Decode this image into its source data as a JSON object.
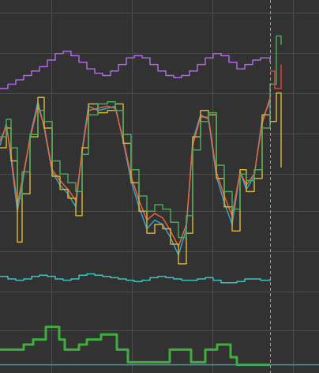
{
  "colors": {
    "background": "#323232",
    "grid": "#4d4d4d",
    "cursor": "#9a9a9a"
  },
  "chart_data": {
    "type": "line",
    "grid": true,
    "cursor_x": 342,
    "x_range": [
      0,
      404
    ],
    "panels": [
      {
        "name": "",
        "y_range": [
          0,
          110
        ],
        "series": [
          {
            "color": "#b067e6",
            "step": true,
            "x": [
              0,
              10,
              20,
              30,
              40,
              50,
              60,
              70,
              80,
              90,
              100,
              110,
              120,
              130,
              140,
              150,
              160,
              170,
              180,
              190,
              200,
              210,
              220,
              230,
              240,
              250,
              260,
              270,
              280,
              290,
              300,
              310,
              320,
              330,
              342
            ],
            "y": [
              84,
              86,
              88,
              90,
              92,
              94,
              97,
              100,
              101,
              99,
              96,
              93,
              91,
              90,
              92,
              95,
              98,
              99,
              98,
              95,
              92,
              90,
              89,
              90,
              92,
              95,
              98,
              100,
              99,
              96,
              93,
              95,
              97,
              98,
              96
            ]
          },
          {
            "color": "#3d9fd1",
            "step": false,
            "x": [
              0,
              8,
              14,
              22,
              28,
              38,
              48,
              56,
              66,
              76,
              86,
              96,
              104,
              112,
              124,
              136,
              146,
              156,
              166,
              176,
              186,
              196,
              206,
              216,
              226,
              236,
              244,
              254,
              264,
              274,
              284,
              294,
              304,
              312,
              322,
              332,
              342
            ],
            "y": [
              58,
              68,
              52,
              28,
              40,
              62,
              78,
              66,
              46,
              40,
              36,
              30,
              56,
              76,
              74,
              75,
              76,
              60,
              42,
              30,
              20,
              24,
              22,
              16,
              8,
              20,
              60,
              72,
              70,
              44,
              32,
              22,
              46,
              38,
              44,
              70,
              78
            ]
          },
          {
            "color": "#e8653a",
            "step": false,
            "x": [
              0,
              8,
              14,
              22,
              28,
              38,
              48,
              56,
              66,
              76,
              86,
              96,
              104,
              112,
              124,
              136,
              146,
              156,
              166,
              176,
              186,
              196,
              206,
              216,
              226,
              236,
              244,
              254,
              264,
              274,
              284,
              294,
              304,
              312,
              322,
              332,
              342
            ],
            "y": [
              60,
              67,
              54,
              31,
              42,
              61,
              76,
              67,
              47,
              42,
              38,
              33,
              55,
              74,
              75,
              76,
              75,
              61,
              44,
              33,
              24,
              27,
              25,
              19,
              12,
              22,
              58,
              71,
              71,
              46,
              35,
              26,
              46,
              40,
              45,
              68,
              80
            ]
          },
          {
            "color": "#d4b22a",
            "step": true,
            "x": [
              0,
              8,
              14,
              22,
              28,
              38,
              48,
              56,
              66,
              76,
              86,
              96,
              104,
              112,
              124,
              136,
              146,
              156,
              166,
              176,
              186,
              196,
              206,
              216,
              226,
              236,
              244,
              254,
              264,
              274,
              284,
              294,
              304,
              312,
              322,
              332,
              342,
              350,
              356
            ],
            "y": [
              57,
              66,
              51,
              14,
              36,
              62,
              80,
              66,
              44,
              38,
              34,
              26,
              57,
              77,
              73,
              74,
              77,
              59,
              41,
              28,
              18,
              22,
              20,
              13,
              4,
              18,
              62,
              74,
              72,
              43,
              30,
              19,
              47,
              37,
              43,
              72,
              69,
              82,
              48
            ]
          },
          {
            "color": "#4aa85a",
            "step": true,
            "x": [
              0,
              8,
              14,
              22,
              28,
              38,
              48,
              56,
              66,
              76,
              86,
              96,
              104,
              112,
              124,
              136,
              146,
              156,
              166,
              176,
              186,
              196,
              206,
              216,
              226,
              236,
              244,
              254,
              264,
              274,
              284,
              294,
              304,
              312,
              322,
              332,
              342,
              350,
              356
            ],
            "y": [
              62,
              70,
              57,
              34,
              46,
              63,
              74,
              69,
              51,
              45,
              41,
              37,
              54,
              72,
              77,
              78,
              74,
              63,
              47,
              35,
              28,
              31,
              29,
              23,
              16,
              26,
              56,
              69,
              73,
              49,
              37,
              29,
              45,
              42,
              47,
              66,
              86,
              108,
              104
            ]
          },
          {
            "color": "#d94040",
            "step": true,
            "x": [
              342,
              348,
              356
            ],
            "y": [
              92,
              84,
              95
            ]
          }
        ]
      },
      {
        "name": "",
        "y_range": [
          0,
          10
        ],
        "series": [
          {
            "color": "#3cc1c1",
            "step": true,
            "x": [
              0,
              10,
              20,
              30,
              40,
              50,
              60,
              70,
              80,
              90,
              100,
              110,
              120,
              130,
              140,
              150,
              160,
              170,
              180,
              190,
              200,
              210,
              220,
              230,
              240,
              250,
              260,
              270,
              280,
              290,
              300,
              310,
              320,
              330,
              342
            ],
            "y": [
              6,
              5,
              4.5,
              5,
              6,
              6.5,
              6,
              5,
              4.5,
              5,
              6.5,
              7,
              6.5,
              6,
              5.5,
              5,
              4.5,
              4,
              4.5,
              5.5,
              6,
              5.5,
              5,
              4.5,
              4.5,
              5,
              5.5,
              4.5,
              3.5,
              3.5,
              4,
              5,
              5,
              4.5,
              5
            ]
          }
        ]
      },
      {
        "name": "",
        "y_range": [
          0,
          10
        ],
        "series": [
          {
            "color": "#3fae3f",
            "step": true,
            "x": [
              0,
              15,
              30,
              42,
              58,
              75,
              82,
              100,
              110,
              128,
              148,
              162,
              200,
              215,
              242,
              260,
              275,
              292,
              300,
              310,
              342
            ],
            "y": [
              4,
              4,
              5,
              6,
              8.5,
              6,
              4,
              5,
              6,
              7,
              4,
              1.5,
              1.5,
              4,
              1.5,
              4,
              5,
              2.5,
              1,
              1,
              1
            ]
          },
          {
            "color": "#3aa0a0",
            "step": true,
            "x": [
              0,
              404
            ],
            "y": [
              1,
              1
            ]
          }
        ]
      }
    ]
  }
}
